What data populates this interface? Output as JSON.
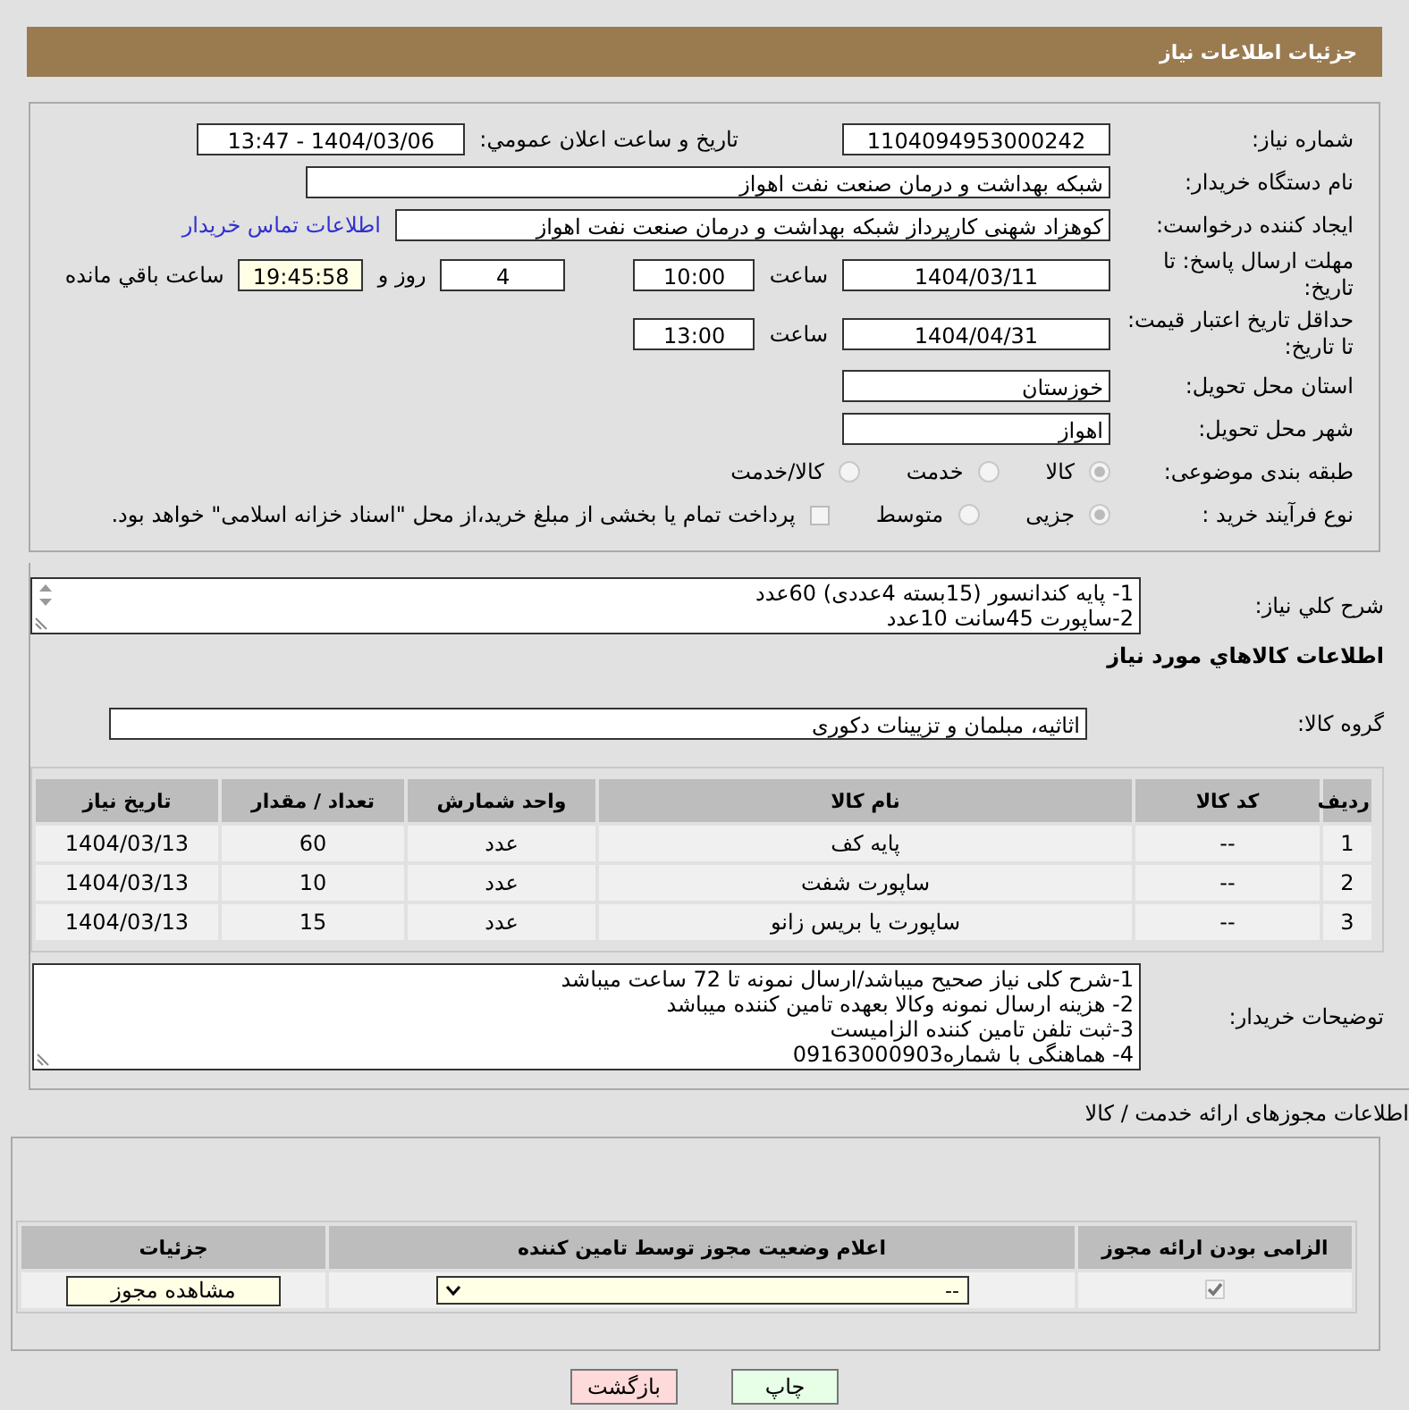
{
  "page_title": "جزئیات اطلاعات نیاز",
  "need_number": {
    "label": "شماره نیاز:",
    "value": "1104094953000242"
  },
  "announce": {
    "label": "تاریخ و ساعت اعلان عمومي:",
    "value": "1404/03/06 - 13:47"
  },
  "buyer_org": {
    "label": "نام دستگاه خریدار:",
    "value": "شبکه بهداشت و درمان صنعت نفت اهواز"
  },
  "requester": {
    "label": "ایجاد کننده درخواست:",
    "value": "کوهزاد شهنی کارپرداز شبکه بهداشت و درمان صنعت نفت اهواز",
    "link": "اطلاعات تماس خریدار"
  },
  "reply_deadline": {
    "label": "مهلت ارسال پاسخ: تا تاریخ:",
    "date": "1404/03/11",
    "time_label": "ساعت",
    "time": "10:00",
    "days": "4",
    "days_label": "روز و",
    "remaining": "19:45:58",
    "remaining_label": "ساعت باقي مانده"
  },
  "price_validity": {
    "label": "حداقل تاریخ اعتبار قیمت: تا تاریخ:",
    "date": "1404/04/31",
    "time_label": "ساعت",
    "time": "13:00"
  },
  "province": {
    "label": "استان محل تحویل:",
    "value": "خوزستان"
  },
  "city": {
    "label": "شهر محل تحویل:",
    "value": "اهواز"
  },
  "category": {
    "label": "طبقه بندی موضوعی:",
    "options": [
      {
        "label": "کالا",
        "selected": true
      },
      {
        "label": "خدمت",
        "selected": false
      },
      {
        "label": "کالا/خدمت",
        "selected": false
      }
    ]
  },
  "process": {
    "label": "نوع فرآیند خرید :",
    "options": [
      {
        "label": "جزیی",
        "selected": true
      },
      {
        "label": "متوسط",
        "selected": false
      }
    ],
    "treasury": {
      "checked": false,
      "text": "پرداخت تمام یا بخشی از مبلغ خرید،از محل \"اسناد خزانه اسلامی\" خواهد بود."
    }
  },
  "description": {
    "label": "شرح کلي نیاز:",
    "lines": [
      "1- پایه کندانسور (15بسته 4عددی) 60عدد",
      "2-ساپورت 45سانت 10عدد"
    ]
  },
  "items_title": "اطلاعات کالاهاي مورد نیاز",
  "goods_group": {
    "label": "گروه کالا:",
    "value": "اثاثیه، مبلمان و تزیینات دکوری"
  },
  "items_table": {
    "columns": [
      "ردیف",
      "کد کالا",
      "نام کالا",
      "واحد شمارش",
      "تعداد / مقدار",
      "تاریخ نیاز"
    ],
    "rows": [
      [
        "1",
        "--",
        "پایه کف",
        "عدد",
        "60",
        "1404/03/13"
      ],
      [
        "2",
        "--",
        "ساپورت شفت",
        "عدد",
        "10",
        "1404/03/13"
      ],
      [
        "3",
        "--",
        "ساپورت یا بریس زانو",
        "عدد",
        "15",
        "1404/03/13"
      ]
    ]
  },
  "buyer_notes": {
    "label": "توضیحات خریدار:",
    "lines": [
      "1-شرح کلی نیاز صحیح میباشد/ارسال نمونه تا 72 ساعت میباشد",
      "2- هزینه ارسال نمونه وکالا بعهده تامین کننده میباشد",
      "3-ثبت تلفن تامین کننده الزامیست",
      "4- هماهنگی با شماره09163000903"
    ]
  },
  "permits_title": "اطلاعات مجوزهای ارائه خدمت / کالا",
  "permits_table": {
    "columns": [
      "الزامی بودن ارائه مجوز",
      "اعلام وضعیت مجوز توسط تامین کننده",
      "جزئیات"
    ],
    "rows": [
      {
        "required": true,
        "status": "--",
        "action": "مشاهده مجوز"
      }
    ]
  },
  "buttons": [
    {
      "label": "چاپ",
      "kind": "print"
    },
    {
      "label": "بازگشت",
      "kind": "back"
    }
  ]
}
